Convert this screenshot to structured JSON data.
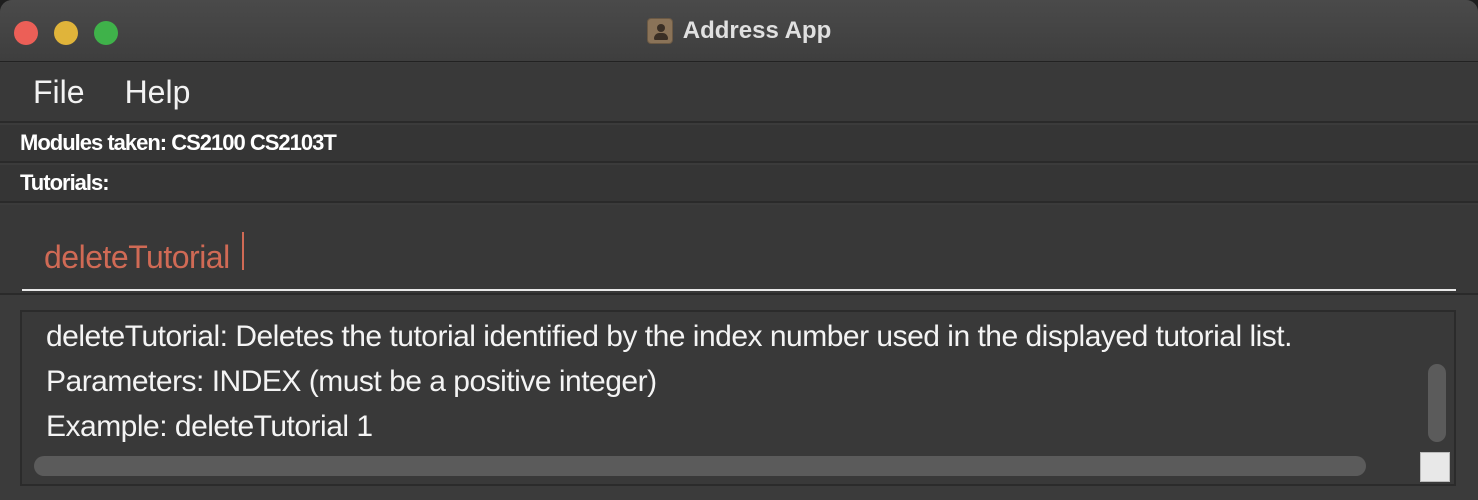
{
  "window": {
    "title": "Address App"
  },
  "menu": {
    "items": [
      {
        "label": "File"
      },
      {
        "label": "Help"
      }
    ]
  },
  "info": {
    "modules_label": "Modules taken: CS2100 CS2103T",
    "tutorials_label": "Tutorials:"
  },
  "command": {
    "value": "deleteTutorial"
  },
  "result": {
    "text": "deleteTutorial: Deletes the tutorial identified by the index number used in the displayed tutorial list.\nParameters: INDEX (must be a positive integer)\nExample: deleteTutorial 1"
  },
  "colors": {
    "command_text": "#d06a55",
    "window_bg": "#3b3b3b"
  }
}
